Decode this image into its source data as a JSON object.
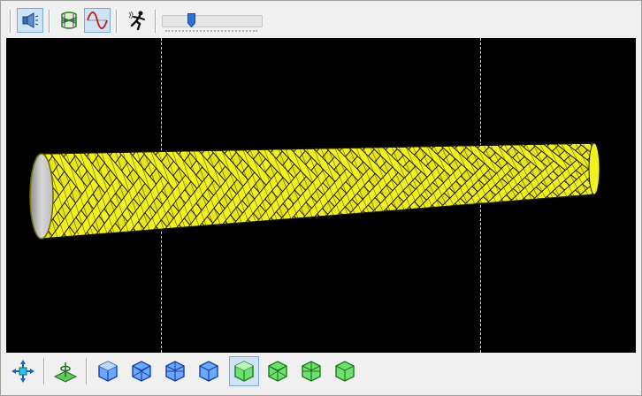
{
  "colors": {
    "viewport_background": "#000000",
    "fiber_yellow": "#f4f01e",
    "fiber_outline": "#1a1a00",
    "mandrel_grey": "#c8c8c8",
    "pressed_button": "#cfe3f7",
    "guide_line": "#d8d8d8"
  },
  "top_toolbar": {
    "buttons": [
      {
        "icon": "speaker-icon",
        "pressed": true
      },
      {
        "icon": "winding-pattern-icon",
        "pressed": false
      },
      {
        "icon": "sine-wave-icon",
        "pressed": true
      },
      {
        "icon": "running-man-icon",
        "pressed": false
      }
    ],
    "speed_slider": {
      "value": 0.28
    }
  },
  "viewport": {
    "object": "filament-wound-tapered-tube"
  },
  "bottom_toolbar": {
    "buttons": [
      {
        "icon": "pan-arrows-icon",
        "pressed": false
      },
      {
        "icon": "floor-plane-icon",
        "pressed": false
      },
      {
        "icon": "cube-view-1-icon",
        "pressed": false
      },
      {
        "icon": "cube-view-2-icon",
        "pressed": false
      },
      {
        "icon": "cube-view-3-icon",
        "pressed": false
      },
      {
        "icon": "cube-view-4-icon",
        "pressed": false
      },
      {
        "icon": "green-cube-view-1-icon",
        "pressed": true
      },
      {
        "icon": "green-cube-view-2-icon",
        "pressed": false
      },
      {
        "icon": "green-cube-view-3-icon",
        "pressed": false
      },
      {
        "icon": "green-cube-view-4-icon",
        "pressed": false
      }
    ]
  }
}
